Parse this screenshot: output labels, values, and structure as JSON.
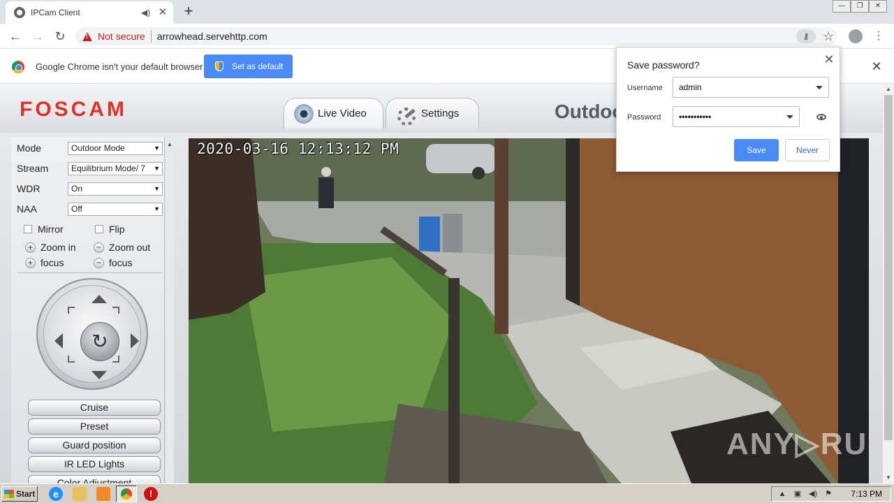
{
  "browser": {
    "tab_title": "IPCam Client",
    "new_tab_label": "+",
    "security_label": "Not secure",
    "url": "arrowhead.servehttp.com",
    "window_buttons": [
      "—",
      "❐",
      "✕"
    ]
  },
  "infobar": {
    "message": "Google Chrome isn't your default browser",
    "set_default_label": "Set as default",
    "close_label": "✕"
  },
  "app": {
    "logo": "FOSCAM",
    "tabs": [
      {
        "label": "Live Video",
        "icon": "camera-icon"
      },
      {
        "label": "Settings",
        "icon": "settings-wrench-icon"
      }
    ],
    "camera_title": "Outdoor Camera"
  },
  "controls": {
    "fields": [
      {
        "label": "Mode",
        "value": "Outdoor Mode"
      },
      {
        "label": "Stream",
        "value": "Equilibrium Mode/ 7"
      },
      {
        "label": "WDR",
        "value": "On"
      },
      {
        "label": "NAA",
        "value": "Off"
      }
    ],
    "mirror_label": "Mirror",
    "flip_label": "Flip",
    "zoom_in_label": "Zoom in",
    "zoom_out_label": "Zoom out",
    "focus_plus_label": "focus",
    "focus_minus_label": "focus",
    "ptz_center": "↻",
    "buttons": [
      "Cruise",
      "Preset",
      "Guard position",
      "IR LED Lights",
      "Color Adjustment"
    ]
  },
  "video": {
    "timestamp": "2020-03-16 12:13:12 PM",
    "watermark": "ANY▷RUN"
  },
  "save_password": {
    "title": "Save password?",
    "username_label": "Username",
    "username_value": "admin",
    "password_label": "Password",
    "password_value": "•••••••••••",
    "save_label": "Save",
    "never_label": "Never",
    "close_label": "✕"
  },
  "taskbar": {
    "start_label": "Start",
    "clock": "7:13 PM"
  },
  "colors": {
    "accent_blue": "#4a8af4",
    "warning_red": "#c5221f",
    "foscam_red": "#e0302a"
  }
}
